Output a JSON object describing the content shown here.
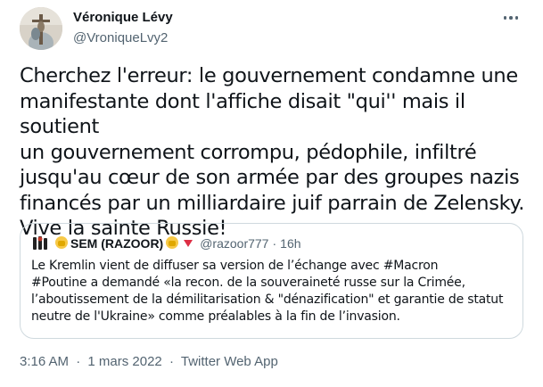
{
  "author": {
    "display_name": "Véronique Lévy",
    "handle": "@VroniqueLvy2"
  },
  "more_icon": "more-horizontal-icon",
  "tweet_text": "Cherchez l'erreur: le gouvernement condamne une\nmanifestante dont l'affiche disait \"qui'' mais il soutient\nun gouvernement corrompu, pédophile, infiltré\njusqu'au cœur de son armée par des groupes nazis\nfinancés par un milliardaire juif parrain de Zelensky.\nVive la sainte Russie!",
  "quoted": {
    "name": "SEM (RAZOOR)",
    "handle": "@razoor777",
    "separator": "·",
    "time": "16h",
    "text": "Le Kremlin vient de diffuser sa version de l’échange avec #Macron\n#Poutine a demandé «la recon. de la souveraineté russe sur la Crimée,\nl’aboutissement de la démilitarisation & \"dénazification\" et garantie de statut\nneutre de l'Ukraine» comme préalables à la fin de l’invasion.",
    "icons": [
      "fist-emoji-icon",
      "fist-emoji-icon",
      "red-triangle-down-icon"
    ]
  },
  "meta": {
    "time": "3:16 AM",
    "separator": "·",
    "date": "1 mars 2022",
    "source": "Twitter Web App"
  }
}
